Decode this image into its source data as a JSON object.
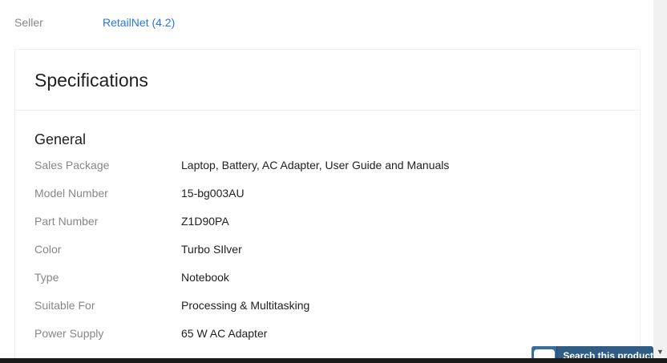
{
  "seller": {
    "label": "Seller",
    "value": "RetailNet (4.2)"
  },
  "specifications": {
    "title": "Specifications",
    "group": {
      "title": "General",
      "rows": [
        {
          "key": "Sales Package",
          "value": "Laptop, Battery, AC Adapter, User Guide and Manuals"
        },
        {
          "key": "Model Number",
          "value": "15-bg003AU"
        },
        {
          "key": "Part Number",
          "value": "Z1D90PA"
        },
        {
          "key": "Color",
          "value": "Turbo SIlver"
        },
        {
          "key": "Type",
          "value": "Notebook"
        },
        {
          "key": "Suitable For",
          "value": "Processing & Multitasking"
        },
        {
          "key": "Power Supply",
          "value": "65 W AC Adapter"
        }
      ]
    }
  },
  "widget": {
    "label": "Search this product",
    "icon": "chat-icon"
  },
  "scrollbar": {
    "down_icon": "▼"
  },
  "colors": {
    "link": "#2874f0",
    "muted_text": "#878787",
    "widget_bg": "#2f5d85"
  }
}
